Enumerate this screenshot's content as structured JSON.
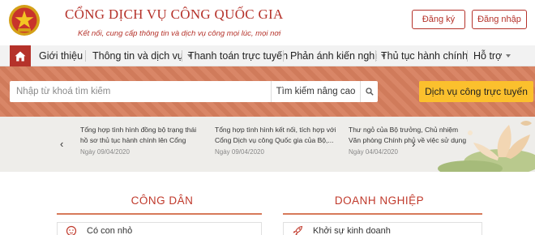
{
  "header": {
    "title": "CỔNG DỊCH VỤ CÔNG QUỐC GIA",
    "subtitle": "Kết nối, cung cấp thông tin và dịch vụ công mọi lúc, mọi nơi",
    "register_label": "Đăng ký",
    "login_label": "Đăng nhập",
    "logo_icon": "national-emblem-icon"
  },
  "nav": {
    "home_icon": "home-icon",
    "items": [
      {
        "label": "Giới thiệu"
      },
      {
        "label": "Thông tin và dịch vụ"
      },
      {
        "label": "Thanh toán trực tuyến"
      },
      {
        "label": "Phản ánh kiến nghị"
      },
      {
        "label": "Thủ tục hành chính"
      },
      {
        "label": "Hỗ trợ"
      }
    ]
  },
  "search": {
    "placeholder": "Nhập từ khoá tìm kiếm",
    "advanced_label": "Tìm kiếm nâng cao",
    "search_icon": "search-icon",
    "online_services_label": "Dịch vụ công trực tuyến"
  },
  "news": {
    "prev_icon": "chevron-left-icon",
    "next_icon": "chevron-right-icon",
    "items": [
      {
        "title": "Tổng hợp tình hình đồng bộ trạng thái hồ sơ thủ tục hành chính lên Cổng Dịc...",
        "date": "Ngày 09/04/2020"
      },
      {
        "title": "Tổng hợp tình hình kết nối, tích hợp với Cổng Dịch vụ công Quốc gia của Bộ,...",
        "date": "Ngày 09/04/2020"
      },
      {
        "title": "Thư ngỏ của Bộ trưởng, Chủ nhiệm Văn phòng Chính phủ về việc sử dụng Cổn...",
        "date": "Ngày 04/04/2020"
      }
    ]
  },
  "sections": {
    "citizen": {
      "title": "CÔNG DÂN",
      "first_item": "Có con nhỏ",
      "first_icon": "baby-icon"
    },
    "business": {
      "title": "DOANH NGHIỆP",
      "first_item": "Khởi sự kinh doanh",
      "first_icon": "rocket-icon"
    }
  },
  "colors": {
    "brand_red": "#b5322a",
    "search_band": "#d77f5e",
    "accent_yellow": "#fbc02d"
  }
}
